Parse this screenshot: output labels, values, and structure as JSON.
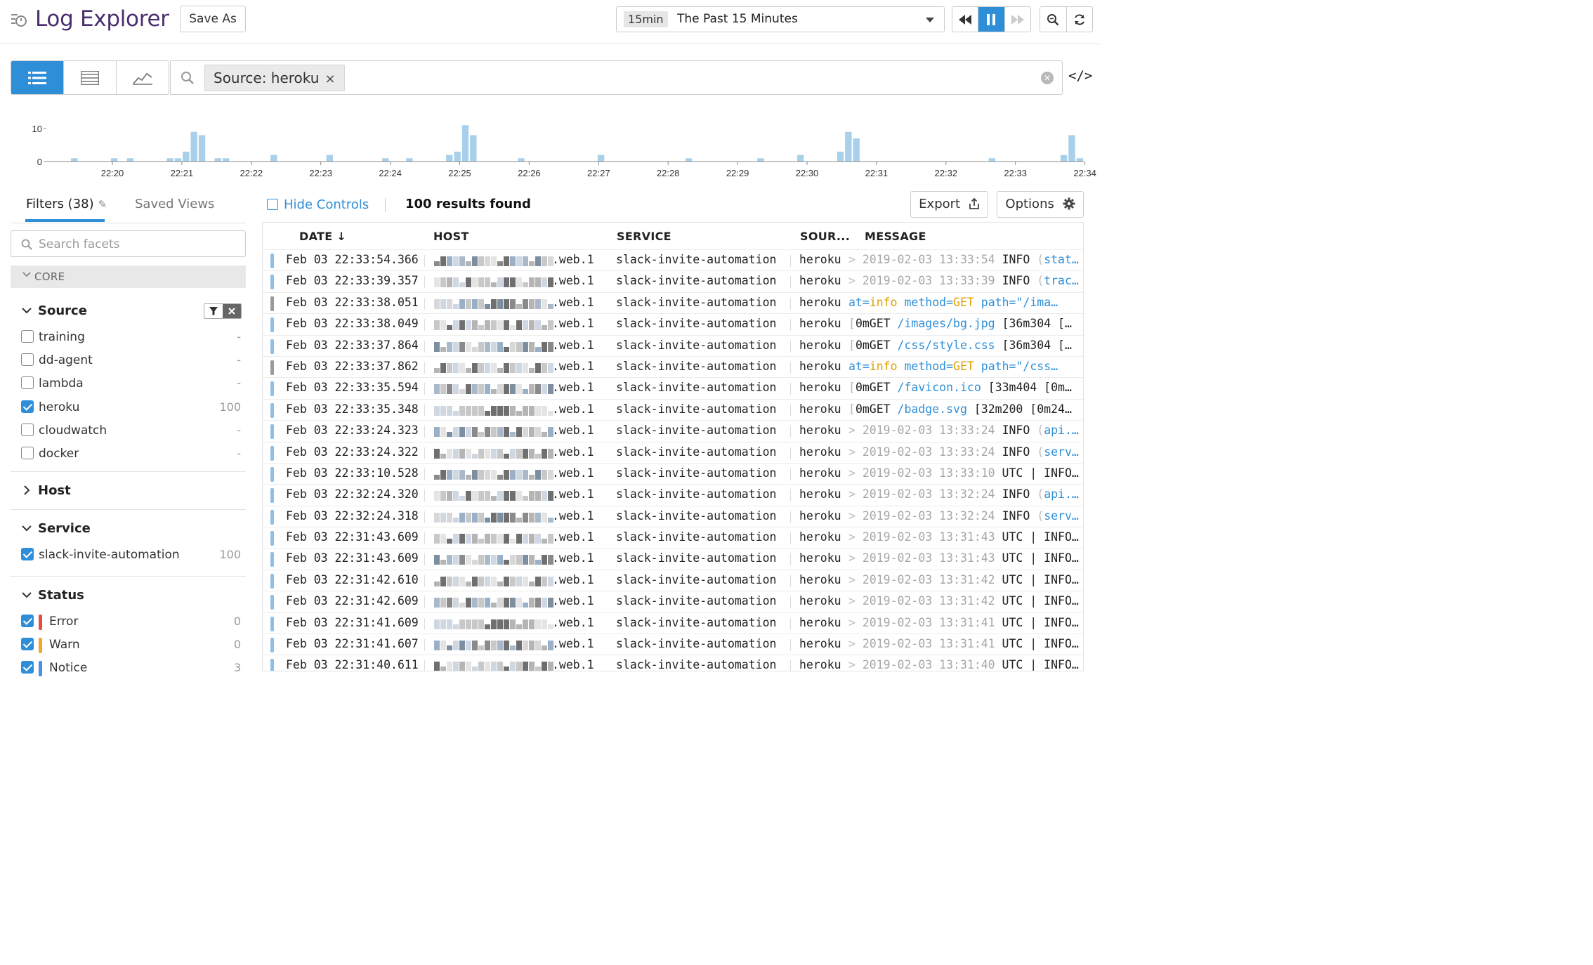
{
  "header": {
    "title": "Log Explorer",
    "save_as_label": "Save As",
    "time_tag": "15min",
    "time_label": "The Past 15 Minutes"
  },
  "search": {
    "query_chip": "Source: heroku",
    "chip_remove": "×"
  },
  "histogram": {
    "y_ticks": [
      "10",
      "0"
    ],
    "x_ticks": [
      "22:20",
      "22:21",
      "22:22",
      "22:23",
      "22:24",
      "22:25",
      "22:26",
      "22:27",
      "22:28",
      "22:29",
      "22:30",
      "22:31",
      "22:32",
      "22:33",
      "22:34"
    ],
    "bar_color": "#a8d0ea",
    "ymax": 10,
    "values": [
      0,
      0,
      0,
      1,
      0,
      0,
      0,
      0,
      1,
      0,
      1,
      0,
      0,
      0,
      0,
      1,
      1,
      3,
      9,
      8,
      0,
      1,
      1,
      0,
      0,
      0,
      0,
      0,
      2,
      0,
      0,
      0,
      0,
      0,
      0,
      2,
      0,
      0,
      0,
      0,
      0,
      0,
      1,
      0,
      0,
      1,
      0,
      0,
      0,
      0,
      2,
      3,
      11,
      8,
      0,
      0,
      0,
      0,
      0,
      1,
      0,
      0,
      0,
      0,
      0,
      0,
      0,
      0,
      0,
      2,
      0,
      0,
      0,
      0,
      0,
      0,
      0,
      0,
      0,
      0,
      1,
      0,
      0,
      0,
      0,
      0,
      0,
      0,
      0,
      1,
      0,
      0,
      0,
      0,
      2,
      0,
      0,
      0,
      0,
      3,
      9,
      7,
      0,
      0,
      0,
      0,
      0,
      0,
      0,
      0,
      0,
      0,
      0,
      0,
      0,
      0,
      0,
      0,
      1,
      0,
      0,
      0,
      0,
      0,
      0,
      0,
      0,
      2,
      8,
      1
    ]
  },
  "sidebar": {
    "tab_filters": "Filters (38)",
    "tab_saved_views": "Saved Views",
    "search_placeholder": "Search facets",
    "core_label": "CORE",
    "source": {
      "title": "Source",
      "items": [
        {
          "name": "training",
          "count": "-",
          "checked": false
        },
        {
          "name": "dd-agent",
          "count": "-",
          "checked": false
        },
        {
          "name": "lambda",
          "count": "-",
          "checked": false
        },
        {
          "name": "heroku",
          "count": "100",
          "checked": true
        },
        {
          "name": "cloudwatch",
          "count": "-",
          "checked": false
        },
        {
          "name": "docker",
          "count": "-",
          "checked": false
        }
      ]
    },
    "host": {
      "title": "Host"
    },
    "service": {
      "title": "Service",
      "items": [
        {
          "name": "slack-invite-automation",
          "count": "100",
          "checked": true
        }
      ]
    },
    "status": {
      "title": "Status",
      "items": [
        {
          "name": "Error",
          "count": "0",
          "checked": true,
          "color": "#e84a40"
        },
        {
          "name": "Warn",
          "count": "0",
          "checked": true,
          "color": "#f5a623"
        },
        {
          "name": "Notice",
          "count": "3",
          "checked": true,
          "color": "#4a90e2"
        }
      ]
    }
  },
  "results": {
    "hide_controls": "Hide Controls",
    "count_label": "100 results found",
    "export_label": "Export",
    "options_label": "Options",
    "columns": [
      "DATE ↓",
      "HOST",
      "SERVICE",
      "SOUR...",
      "MESSAGE"
    ],
    "rows": [
      {
        "date": "Feb 03 22:33:54.366",
        "host": ".web.1",
        "service": "slack-invite-automation",
        "source": "heroku",
        "msg_type": "ts",
        "ts": "2019-02-03 13:33:54",
        "level": "INFO",
        "tail": "stat…",
        "bar": "blue"
      },
      {
        "date": "Feb 03 22:33:39.357",
        "host": ".web.1",
        "service": "slack-invite-automation",
        "source": "heroku",
        "msg_type": "ts",
        "ts": "2019-02-03 13:33:39",
        "level": "INFO",
        "tail": "trac…",
        "bar": "blue"
      },
      {
        "date": "Feb 03 22:33:38.051",
        "host": ".web.1",
        "service": "slack-invite-automation",
        "source": "heroku",
        "msg_type": "kv",
        "method": "GET",
        "path": "/ima…",
        "bar": "gray"
      },
      {
        "date": "Feb 03 22:33:38.049",
        "host": ".web.1",
        "service": "slack-invite-automation",
        "source": "heroku",
        "msg_type": "req",
        "req_path": "/images/bg.jpg",
        "req_tail": "[36m304 […",
        "bar": "blue"
      },
      {
        "date": "Feb 03 22:33:37.864",
        "host": ".web.1",
        "service": "slack-invite-automation",
        "source": "heroku",
        "msg_type": "req",
        "req_path": "/css/style.css",
        "req_tail": "[36m304 […",
        "bar": "blue"
      },
      {
        "date": "Feb 03 22:33:37.862",
        "host": ".web.1",
        "service": "slack-invite-automation",
        "source": "heroku",
        "msg_type": "kv",
        "method": "GET",
        "path": "/css…",
        "bar": "gray"
      },
      {
        "date": "Feb 03 22:33:35.594",
        "host": ".web.1",
        "service": "slack-invite-automation",
        "source": "heroku",
        "msg_type": "req",
        "req_path": "/favicon.ico",
        "req_tail": "[33m404 [0m…",
        "bar": "blue"
      },
      {
        "date": "Feb 03 22:33:35.348",
        "host": ".web.1",
        "service": "slack-invite-automation",
        "source": "heroku",
        "msg_type": "req",
        "req_path": "/badge.svg",
        "req_tail": "[32m200 [0m24…",
        "bar": "blue"
      },
      {
        "date": "Feb 03 22:33:24.323",
        "host": ".web.1",
        "service": "slack-invite-automation",
        "source": "heroku",
        "msg_type": "ts",
        "ts": "2019-02-03 13:33:24",
        "level": "INFO",
        "tail": "api.…",
        "bar": "blue"
      },
      {
        "date": "Feb 03 22:33:24.322",
        "host": ".web.1",
        "service": "slack-invite-automation",
        "source": "heroku",
        "msg_type": "ts",
        "ts": "2019-02-03 13:33:24",
        "level": "INFO",
        "tail": "serv…",
        "bar": "blue"
      },
      {
        "date": "Feb 03 22:33:10.528",
        "host": ".web.1",
        "service": "slack-invite-automation",
        "source": "heroku",
        "msg_type": "utc",
        "ts": "2019-02-03 13:33:10",
        "bar": "blue"
      },
      {
        "date": "Feb 03 22:32:24.320",
        "host": ".web.1",
        "service": "slack-invite-automation",
        "source": "heroku",
        "msg_type": "ts",
        "ts": "2019-02-03 13:32:24",
        "level": "INFO",
        "tail": "api.…",
        "bar": "blue"
      },
      {
        "date": "Feb 03 22:32:24.318",
        "host": ".web.1",
        "service": "slack-invite-automation",
        "source": "heroku",
        "msg_type": "ts",
        "ts": "2019-02-03 13:32:24",
        "level": "INFO",
        "tail": "serv…",
        "bar": "blue"
      },
      {
        "date": "Feb 03 22:31:43.609",
        "host": ".web.1",
        "service": "slack-invite-automation",
        "source": "heroku",
        "msg_type": "utc",
        "ts": "2019-02-03 13:31:43",
        "bar": "blue"
      },
      {
        "date": "Feb 03 22:31:43.609",
        "host": ".web.1",
        "service": "slack-invite-automation",
        "source": "heroku",
        "msg_type": "utc",
        "ts": "2019-02-03 13:31:43",
        "bar": "blue"
      },
      {
        "date": "Feb 03 22:31:42.610",
        "host": ".web.1",
        "service": "slack-invite-automation",
        "source": "heroku",
        "msg_type": "utc",
        "ts": "2019-02-03 13:31:42",
        "bar": "blue"
      },
      {
        "date": "Feb 03 22:31:42.609",
        "host": ".web.1",
        "service": "slack-invite-automation",
        "source": "heroku",
        "msg_type": "utc",
        "ts": "2019-02-03 13:31:42",
        "bar": "blue"
      },
      {
        "date": "Feb 03 22:31:41.609",
        "host": ".web.1",
        "service": "slack-invite-automation",
        "source": "heroku",
        "msg_type": "utc",
        "ts": "2019-02-03 13:31:41",
        "bar": "blue"
      },
      {
        "date": "Feb 03 22:31:41.607",
        "host": ".web.1",
        "service": "slack-invite-automation",
        "source": "heroku",
        "msg_type": "utc",
        "ts": "2019-02-03 13:31:41",
        "bar": "blue"
      },
      {
        "date": "Feb 03 22:31:40.611",
        "host": ".web.1",
        "service": "slack-invite-automation",
        "source": "heroku",
        "msg_type": "utc",
        "ts": "2019-02-03 13:31:40",
        "bar": "blue"
      }
    ]
  },
  "colors": {
    "accent": "#2e8fd8",
    "brand_title": "#4a2f6f",
    "error": "#e84a40",
    "warn": "#f5a623",
    "notice": "#4a90e2"
  }
}
